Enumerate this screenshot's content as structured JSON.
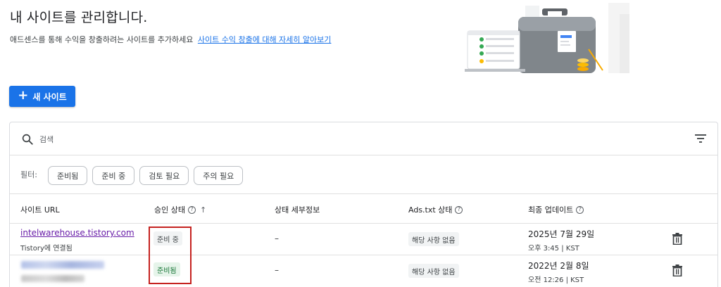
{
  "header": {
    "title": "내 사이트를 관리합니다.",
    "subtitle": "애드센스를 통해 수익을 창출하려는 사이트를 추가하세요",
    "learn_more_link": "사이트 수익 창출에 대해 자세히 알아보기"
  },
  "toolbar": {
    "new_site_label": "새 사이트",
    "new_site_icon": "plus-icon"
  },
  "search": {
    "placeholder": "검색",
    "icon": "search-icon",
    "filter_icon": "filter-list-icon"
  },
  "filters": {
    "label": "필터:",
    "chips": [
      "준비됨",
      "준비 중",
      "검토 필요",
      "주의 필요"
    ]
  },
  "table": {
    "columns": [
      {
        "label": "사이트 URL"
      },
      {
        "label": "승인 상태",
        "help": "?",
        "sort": "↑"
      },
      {
        "label": "상태 세부정보"
      },
      {
        "label": "Ads.txt 상태",
        "help": "?"
      },
      {
        "label": "최종 업데이트",
        "help": "?"
      }
    ],
    "rows": [
      {
        "url": "intelwarehouse.tistory.com",
        "connection": "Tistory에 연결됨",
        "status": "준비 중",
        "detail": "–",
        "ads_txt": "해당 사항 없음",
        "date": "2025년 7월 29일",
        "time": "오후 3:45 | KST"
      },
      {
        "url_redacted": true,
        "status": "준비됨",
        "detail": "–",
        "ads_txt": "해당 사항 없음",
        "date": "2022년 2월 8일",
        "time": "오전 12:26 | KST"
      }
    ]
  },
  "colors": {
    "primary": "#1a73e8",
    "visited_link": "#681da8",
    "ready_bg": "#e6f4ea",
    "ready_text": "#137333",
    "highlight": "#c5221f"
  }
}
